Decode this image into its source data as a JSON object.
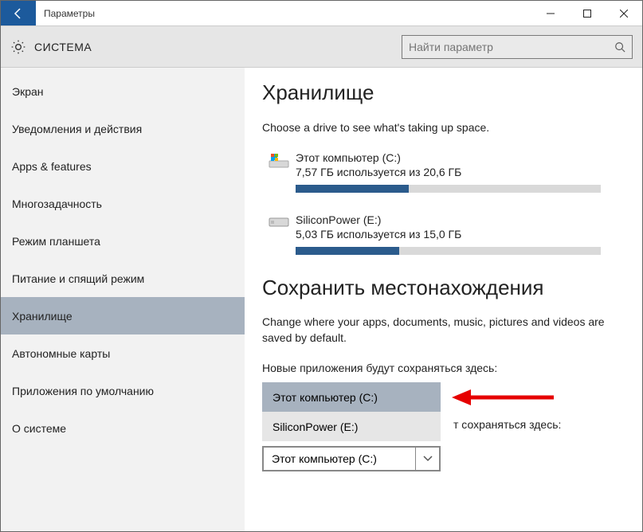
{
  "window": {
    "title": "Параметры"
  },
  "header": {
    "section": "СИСТЕМА",
    "search_placeholder": "Найти параметр"
  },
  "sidebar": {
    "items": [
      {
        "label": "Экран"
      },
      {
        "label": "Уведомления и действия"
      },
      {
        "label": "Apps & features"
      },
      {
        "label": "Многозадачность"
      },
      {
        "label": "Режим планшета"
      },
      {
        "label": "Питание и спящий режим"
      },
      {
        "label": "Хранилище"
      },
      {
        "label": "Автономные карты"
      },
      {
        "label": "Приложения по умолчанию"
      },
      {
        "label": "О системе"
      }
    ],
    "selected_index": 6
  },
  "storage": {
    "title": "Хранилище",
    "subtitle": "Choose a drive to see what's taking up space.",
    "drives": [
      {
        "name": "Этот компьютер (C:)",
        "usage_text": "7,57 ГБ используется из 20,6 ГБ",
        "fill_pct": 37
      },
      {
        "name": "SiliconPower (E:)",
        "usage_text": "5,03 ГБ используется из 15,0 ГБ",
        "fill_pct": 34
      }
    ]
  },
  "save_locations": {
    "title": "Сохранить местонахождения",
    "description": "Change where your apps, documents, music, pictures and videos are saved by default.",
    "apps_label": "Новые приложения будут сохраняться здесь:",
    "apps_options": [
      "Этот компьютер (C:)",
      "SiliconPower (E:)"
    ],
    "docs_label_fragment": "т сохраняться здесь:",
    "docs_value": "Этот компьютер (C:)"
  }
}
